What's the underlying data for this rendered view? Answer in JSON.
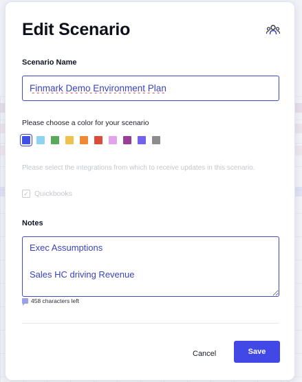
{
  "modal": {
    "title": "Edit Scenario",
    "team_icon": "people-group-icon"
  },
  "scenario_name": {
    "label": "Scenario Name",
    "value": "Finmark Demo Environment Plan"
  },
  "color_picker": {
    "prompt": "Please choose a color for your scenario",
    "selected_index": 0,
    "colors": [
      "#4050e0",
      "#8ed3f2",
      "#58a95a",
      "#f0c14e",
      "#ed8a33",
      "#dc4c3a",
      "#e2a3ec",
      "#9b3f96",
      "#7462ec",
      "#8d8d8d"
    ]
  },
  "integrations": {
    "text": "Please select the integrations from which to receive updates in this scenario.",
    "options": [
      {
        "label": "Quickbooks",
        "checked": true,
        "disabled": true
      }
    ]
  },
  "notes": {
    "label": "Notes",
    "value": "Exec Assumptions\n\nSales HC driving Revenue",
    "chars_left": "458 characters left",
    "chars_icon": "chat-bubble-icon"
  },
  "footer": {
    "cancel_label": "Cancel",
    "save_label": "Save"
  },
  "colors": {
    "accent": "#4148e6",
    "input_text": "#3a42bd"
  }
}
